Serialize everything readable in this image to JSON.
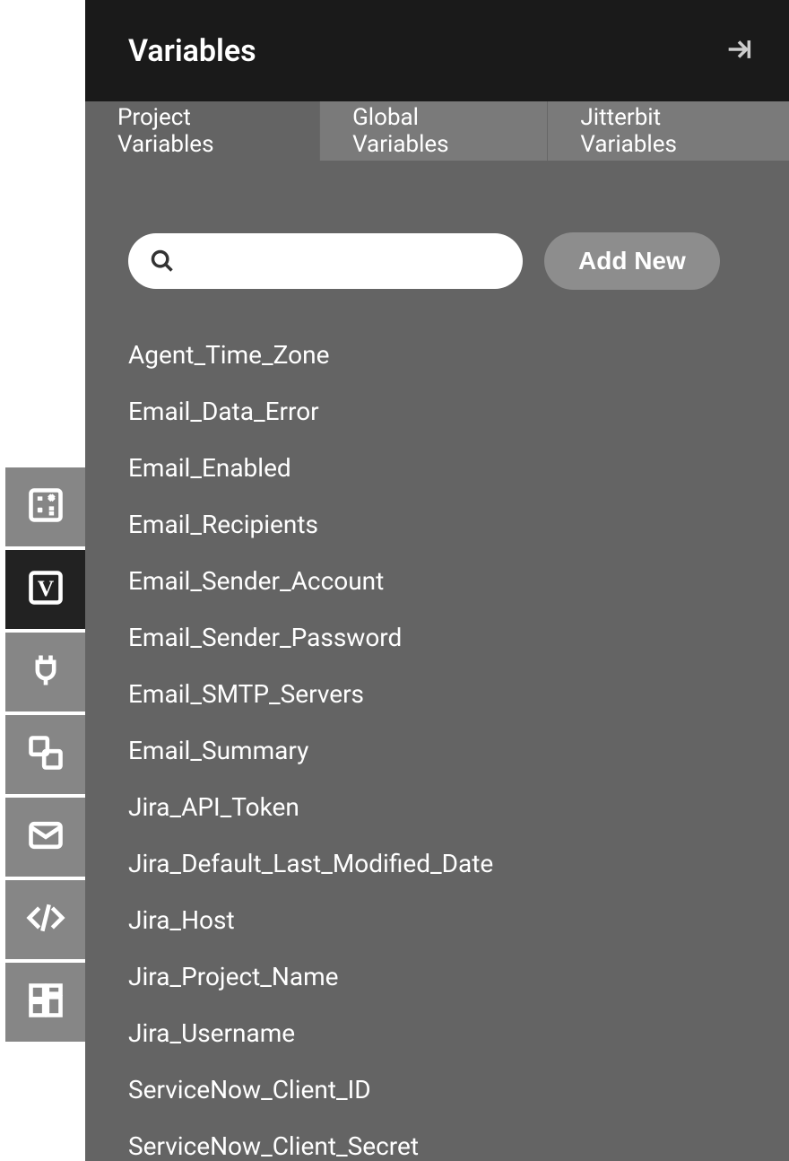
{
  "header": {
    "title": "Variables"
  },
  "tabs": {
    "items": [
      {
        "label": "Project Variables",
        "active": true
      },
      {
        "label": "Global Variables",
        "active": false
      },
      {
        "label": "Jitterbit Variables",
        "active": false
      }
    ]
  },
  "toolbar": {
    "search_placeholder": "",
    "search_value": "",
    "add_label": "Add New"
  },
  "variables": [
    "Agent_Time_Zone",
    "Email_Data_Error",
    "Email_Enabled",
    "Email_Recipients",
    "Email_Sender_Account",
    "Email_Sender_Password",
    "Email_SMTP_Servers",
    "Email_Summary",
    "Jira_API_Token",
    "Jira_Default_Last_Modified_Date",
    "Jira_Host",
    "Jira_Project_Name",
    "Jira_Username",
    "ServiceNow_Client_ID",
    "ServiceNow_Client_Secret"
  ],
  "rail": {
    "items": [
      {
        "name": "calculator-icon",
        "active": false
      },
      {
        "name": "variables-icon",
        "active": true
      },
      {
        "name": "plug-icon",
        "active": false
      },
      {
        "name": "link-icon",
        "active": false
      },
      {
        "name": "mail-icon",
        "active": false
      },
      {
        "name": "code-icon",
        "active": false
      },
      {
        "name": "grid-icon",
        "active": false
      }
    ]
  }
}
